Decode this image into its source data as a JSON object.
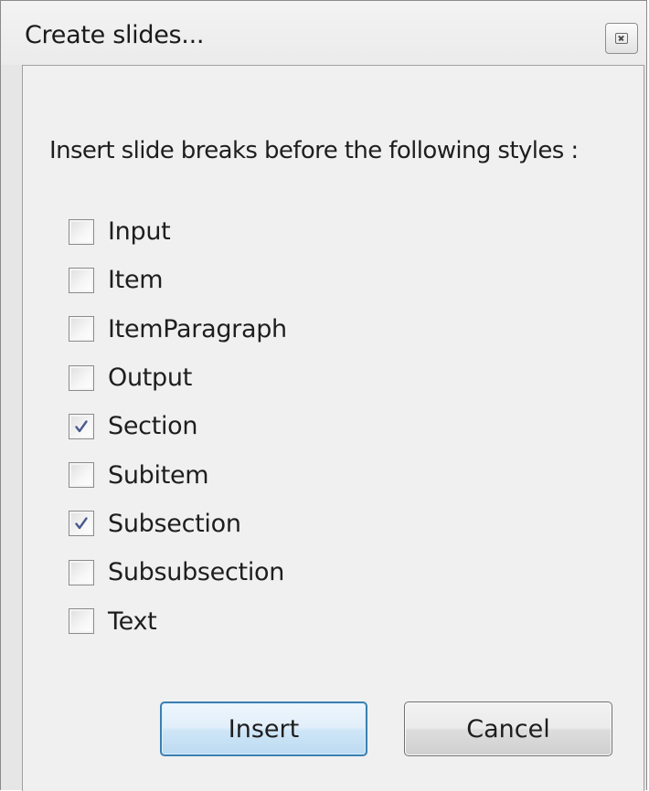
{
  "dialog": {
    "title": "Create slides...",
    "prompt": "Insert slide breaks before the following styles :"
  },
  "styles": [
    {
      "label": "Input",
      "checked": false
    },
    {
      "label": "Item",
      "checked": false
    },
    {
      "label": "ItemParagraph",
      "checked": false
    },
    {
      "label": "Output",
      "checked": false
    },
    {
      "label": "Section",
      "checked": true
    },
    {
      "label": "Subitem",
      "checked": false
    },
    {
      "label": "Subsection",
      "checked": true
    },
    {
      "label": "Subsubsection",
      "checked": false
    },
    {
      "label": "Text",
      "checked": false
    }
  ],
  "buttons": {
    "insert_label": "Insert",
    "cancel_label": "Cancel"
  },
  "icons": {
    "close": "close-icon",
    "check": "checkmark-icon"
  },
  "colors": {
    "checkmark": "#4a5a8c",
    "default_button_border": "#3c7fb1"
  }
}
